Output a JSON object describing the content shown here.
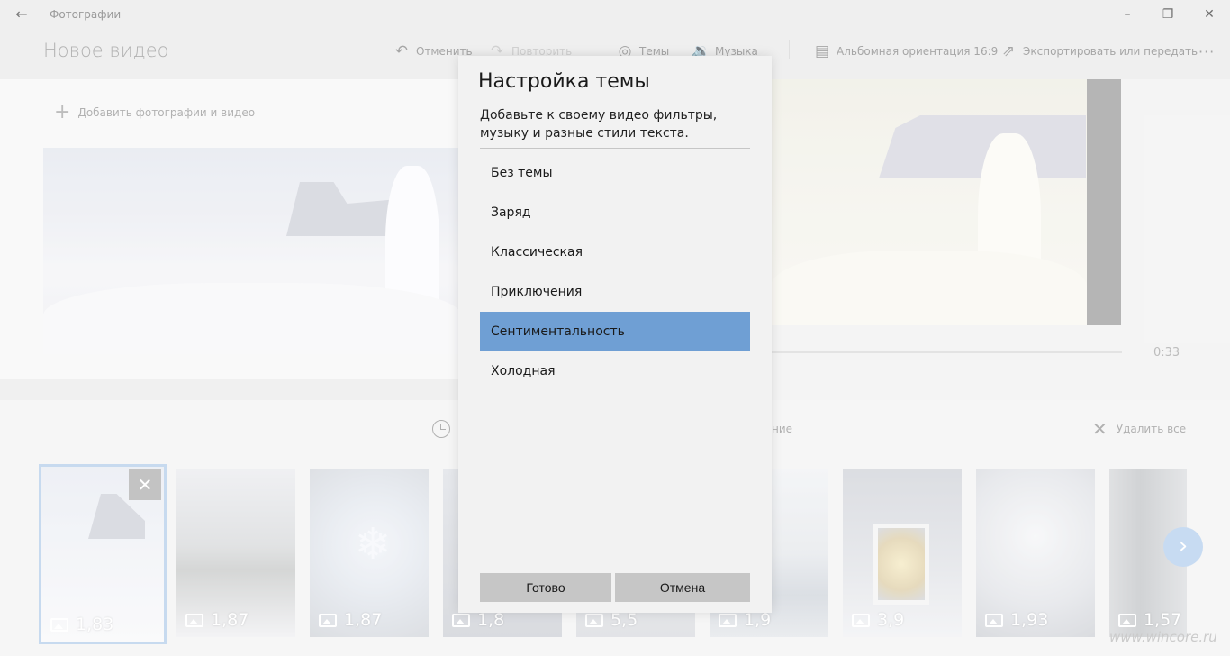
{
  "window": {
    "app_title": "Фотографии",
    "minimize": "–",
    "maximize": "❐",
    "close": "✕"
  },
  "toolbar": {
    "project_title": "Новое видео",
    "undo_label": "Отменить",
    "redo_label": "Повторить",
    "themes_label": "Темы",
    "music_label": "Музыка",
    "orientation_label": "Альбомная ориентация 16:9",
    "export_label": "Экспортировать или передать",
    "more_label": "···"
  },
  "library": {
    "add_label": "Добавить фотографии и видео"
  },
  "preview": {
    "duration": "0:33"
  },
  "storyboard": {
    "partial_text": "ние",
    "remove_all_label": "Удалить все",
    "clips": [
      {
        "duration": "1,83",
        "selected": true
      },
      {
        "duration": "1,87"
      },
      {
        "duration": "1,87"
      },
      {
        "duration": "1,8"
      },
      {
        "duration": "5,5"
      },
      {
        "duration": "1,9"
      },
      {
        "duration": "3,9"
      },
      {
        "duration": "1,93"
      },
      {
        "duration": "1,57"
      }
    ]
  },
  "dialog": {
    "title": "Настройка темы",
    "description": "Добавьте к своему видео фильтры, музыку и разные стили текста.",
    "themes": [
      {
        "label": "Без темы"
      },
      {
        "label": "Заряд"
      },
      {
        "label": "Классическая"
      },
      {
        "label": "Приключения"
      },
      {
        "label": "Сентиментальность",
        "selected": true
      },
      {
        "label": "Холодная"
      }
    ],
    "done_label": "Готово",
    "cancel_label": "Отмена"
  },
  "watermark": "www.wincore.ru",
  "colors": {
    "selection": "#6f9fd4",
    "accent_light": "#a9c8ec"
  }
}
